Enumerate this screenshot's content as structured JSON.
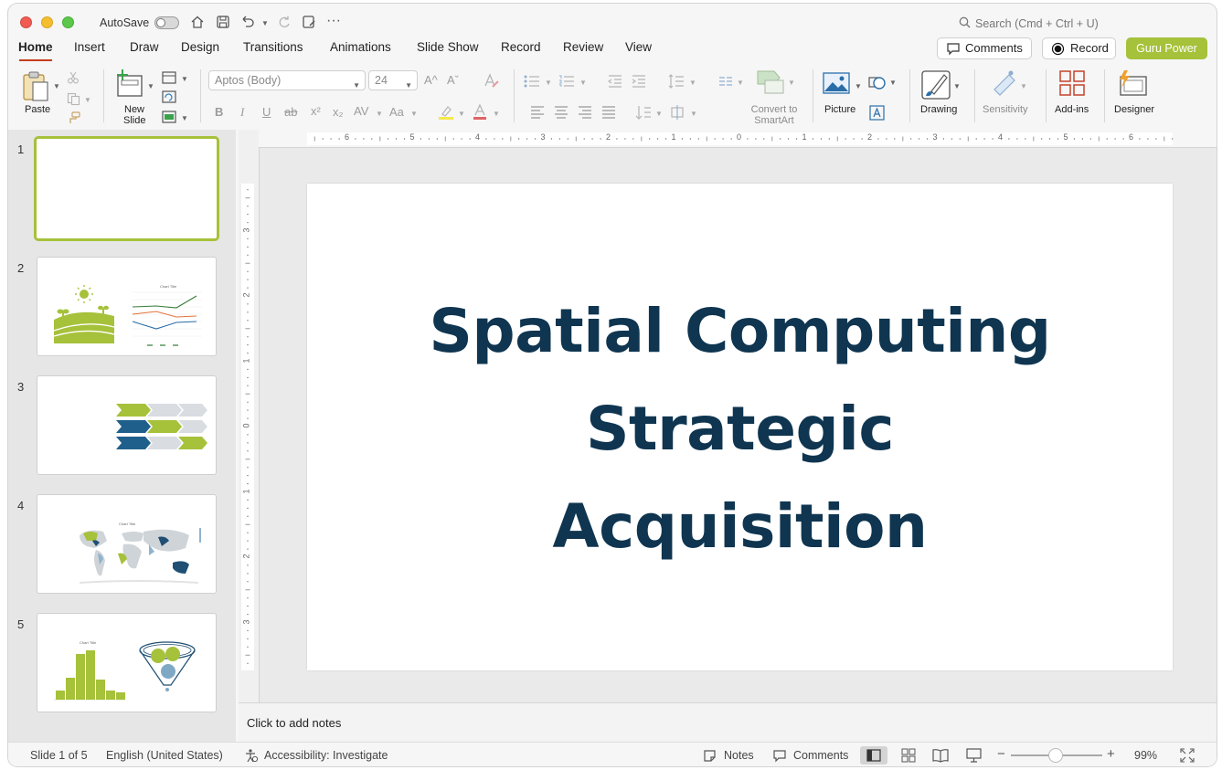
{
  "titlebar": {
    "autosave_label": "AutoSave",
    "search_placeholder": "Search (Cmd + Ctrl + U)"
  },
  "tabs": [
    "Home",
    "Insert",
    "Draw",
    "Design",
    "Transitions",
    "Animations",
    "Slide Show",
    "Record",
    "Review",
    "View"
  ],
  "header_buttons": {
    "comments": "Comments",
    "record": "Record",
    "guru": "Guru Power"
  },
  "colors": {
    "accent_green": "#a6c13a",
    "title_navy": "#0f3550",
    "active_tab_underline": "#c43e1c"
  },
  "ribbon": {
    "paste": "Paste",
    "new_slide_1": "New",
    "new_slide_2": "Slide",
    "font_name": "Aptos (Body)",
    "font_size": "24",
    "convert_1": "Convert to",
    "convert_2": "SmartArt",
    "picture": "Picture",
    "drawing": "Drawing",
    "sensitivity": "Sensitivity",
    "addins": "Add-ins",
    "designer": "Designer",
    "bold": "B",
    "italic": "I",
    "underline": "U",
    "strike": "ab",
    "superscript": "x²",
    "subscript": "x₂",
    "char_spacing": "AV",
    "change_case": "Aa",
    "grow": "A^",
    "shrink": "Aˇ"
  },
  "ruler": {
    "top_ticks": [
      "6",
      "5",
      "4",
      "3",
      "2",
      "1",
      "0",
      "1",
      "2",
      "3",
      "4",
      "5",
      "6"
    ],
    "left_ticks": [
      "3",
      "2",
      "1",
      "0",
      "1",
      "2",
      "3"
    ]
  },
  "thumbnails": [
    {
      "number": "1"
    },
    {
      "number": "2",
      "chart_title": "Chart Title"
    },
    {
      "number": "3"
    },
    {
      "number": "4",
      "chart_title": "Chart Title"
    },
    {
      "number": "5",
      "chart_title": "Chart Title"
    }
  ],
  "slide": {
    "title_line1": "Spatial Computing",
    "title_line2": "Strategic",
    "title_line3": "Acquisition"
  },
  "notes_placeholder": "Click to add notes",
  "status": {
    "slide_info": "Slide 1 of 5",
    "language": "English (United States)",
    "accessibility": "Accessibility: Investigate",
    "notes": "Notes",
    "comments": "Comments",
    "zoom": "99%"
  }
}
